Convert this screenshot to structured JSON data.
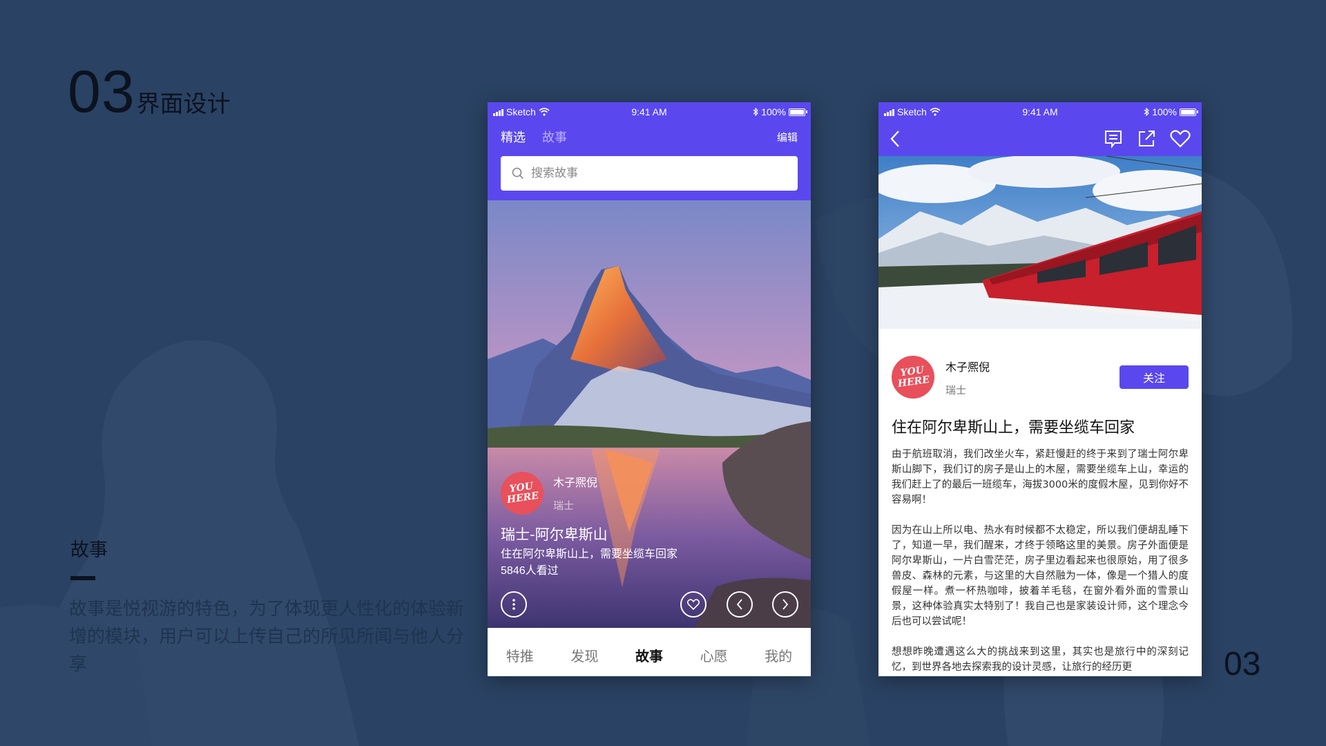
{
  "colors": {
    "background": "#2a4263",
    "accent": "#5a48ee",
    "avatar": "#e8505b"
  },
  "slide": {
    "section_number": "03",
    "section_label": "界面设计",
    "feature_title": "故事",
    "feature_description": "故事是悦视游的特色，为了体现更人性化的体验新增的模块，用户可以上传自己的所见所闻与他人分享",
    "page_number": "03"
  },
  "status_bar": {
    "carrier": "Sketch",
    "time": "9:41 AM",
    "battery": "100%"
  },
  "list_screen": {
    "tabs": [
      "精选",
      "故事"
    ],
    "edit_label": "编辑",
    "search": {
      "placeholder": "搜索故事",
      "icon": "search-icon"
    },
    "story": {
      "avatar_text": [
        "YOU",
        "HERE"
      ],
      "author": "木子熈倪",
      "location": "瑞士",
      "title": "瑞士-阿尔卑斯山",
      "subtitle": "住在阿尔卑斯山上，需要坐缆车回家",
      "views": "5846人看过"
    },
    "bottom_tabs": [
      {
        "label": "特推",
        "active": false
      },
      {
        "label": "发现",
        "active": false
      },
      {
        "label": "故事",
        "active": true
      },
      {
        "label": "心愿",
        "active": false
      },
      {
        "label": "我的",
        "active": false
      }
    ]
  },
  "detail_screen": {
    "nav_icons": [
      "back-icon",
      "comment-icon",
      "share-icon",
      "heart-icon"
    ],
    "author": "木子熈倪",
    "location": "瑞士",
    "follow_label": "关注",
    "title": "住在阿尔卑斯山上，需要坐缆车回家",
    "paragraphs": [
      "由于航班取消，我们改坐火车，紧赶慢赶的终于来到了瑞士阿尔卑斯山脚下，我们订的房子是山上的木屋，需要坐缆车上山，幸运的我们赶上了的最后一班缆车，海拔3000米的度假木屋，见到你好不容易啊！",
      "因为在山上所以电、热水有时候都不太稳定，所以我们便胡乱睡下了，知道一早，我们醒来，才终于领略这里的美景。房子外面便是阿尔卑斯山，一片白雪茫茫，房子里边看起来也很原始，用了很多兽皮、森林的元素，与这里的大自然融为一体，像是一个猎人的度假屋一样。煮一杯热咖啡，披着羊毛毯，在窗外看外面的雪景山景，这种体验真实太特别了！我自己也是家装设计师，这个理念今后也可以尝试呢！",
      "想想昨晚遭遇这么大的挑战来到这里，其实也是旅行中的深刻记忆，到世界各地去探索我的设计灵感，让旅行的经历更"
    ]
  }
}
